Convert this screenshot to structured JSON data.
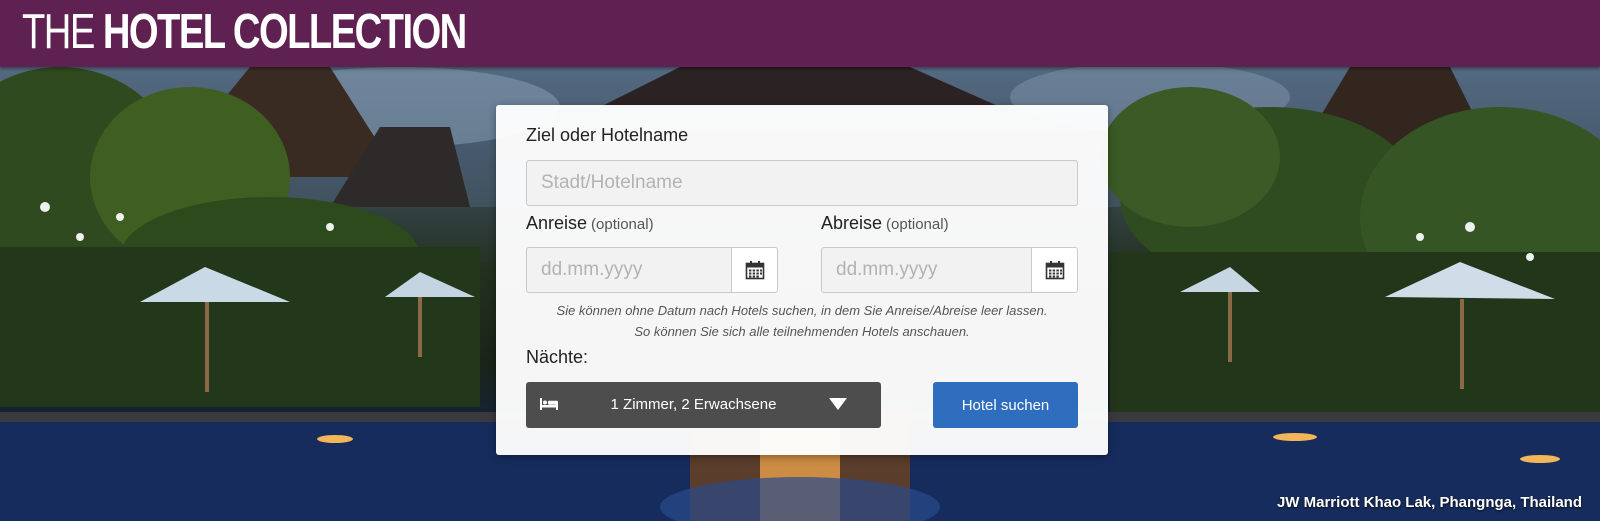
{
  "brand": {
    "logo_thin": "THE",
    "logo_bold": "HOTEL COLLECTION",
    "header_color": "#5e2152"
  },
  "hero": {
    "caption": "JW Marriott Khao Lak, Phangnga, Thailand"
  },
  "search_form": {
    "destination_label": "Ziel oder Hotelname",
    "destination_placeholder": "Stadt/Hotelname",
    "destination_value": "",
    "checkin_label": "Anreise",
    "checkin_optional": "(optional)",
    "checkin_placeholder": "dd.mm.yyyy",
    "checkin_value": "",
    "checkout_label": "Abreise",
    "checkout_optional": "(optional)",
    "checkout_placeholder": "dd.mm.yyyy",
    "checkout_value": "",
    "calendar_icon": "calendar-icon",
    "hint_line1": "Sie können ohne Datum nach Hotels suchen, in dem Sie Anreise/Abreise leer lassen.",
    "hint_line2": "So können Sie sich alle teilnehmenden Hotels anschauen.",
    "nights_label": "Nächte:",
    "rooms_value": "1 Zimmer, 2 Erwachsene",
    "rooms_icon": "bed-icon",
    "search_button": "Hotel suchen",
    "search_button_color": "#2f6dbf",
    "rooms_select_color": "#4d4d4d"
  }
}
